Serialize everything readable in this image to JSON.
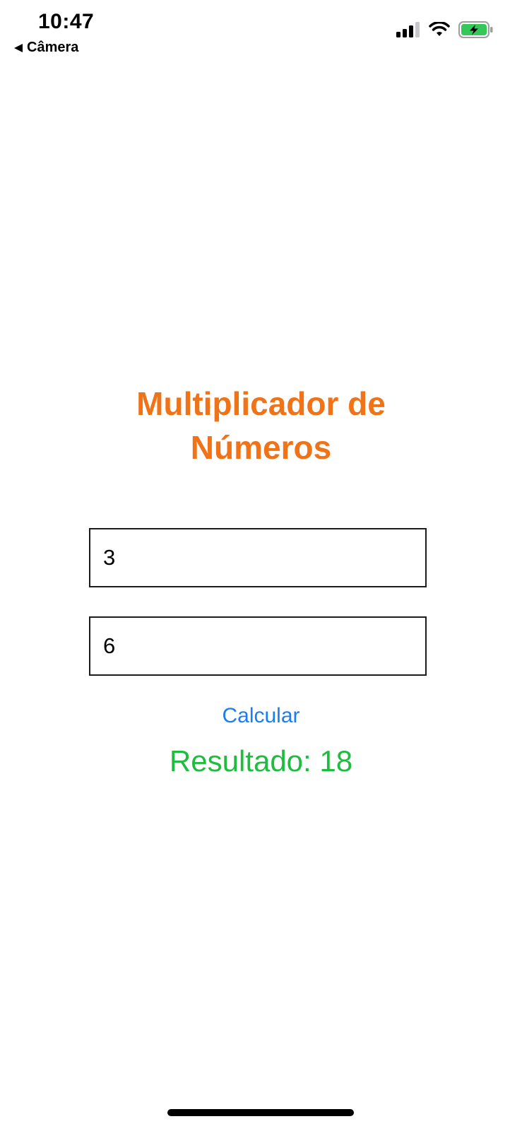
{
  "status_bar": {
    "time": "10:47",
    "back_label": "Câmera",
    "icons": [
      "cellular-signal-icon",
      "wifi-icon",
      "battery-charging-icon"
    ]
  },
  "app": {
    "title_line1": "Multiplicador de",
    "title_line2": "Números",
    "input1_value": "3",
    "input2_value": "6",
    "calculate_label": "Calcular",
    "result_text": "Resultado: 18"
  },
  "colors": {
    "title": "#f07318",
    "button": "#1a7ef0",
    "result": "#1fbd3f",
    "battery": "#34c759"
  }
}
